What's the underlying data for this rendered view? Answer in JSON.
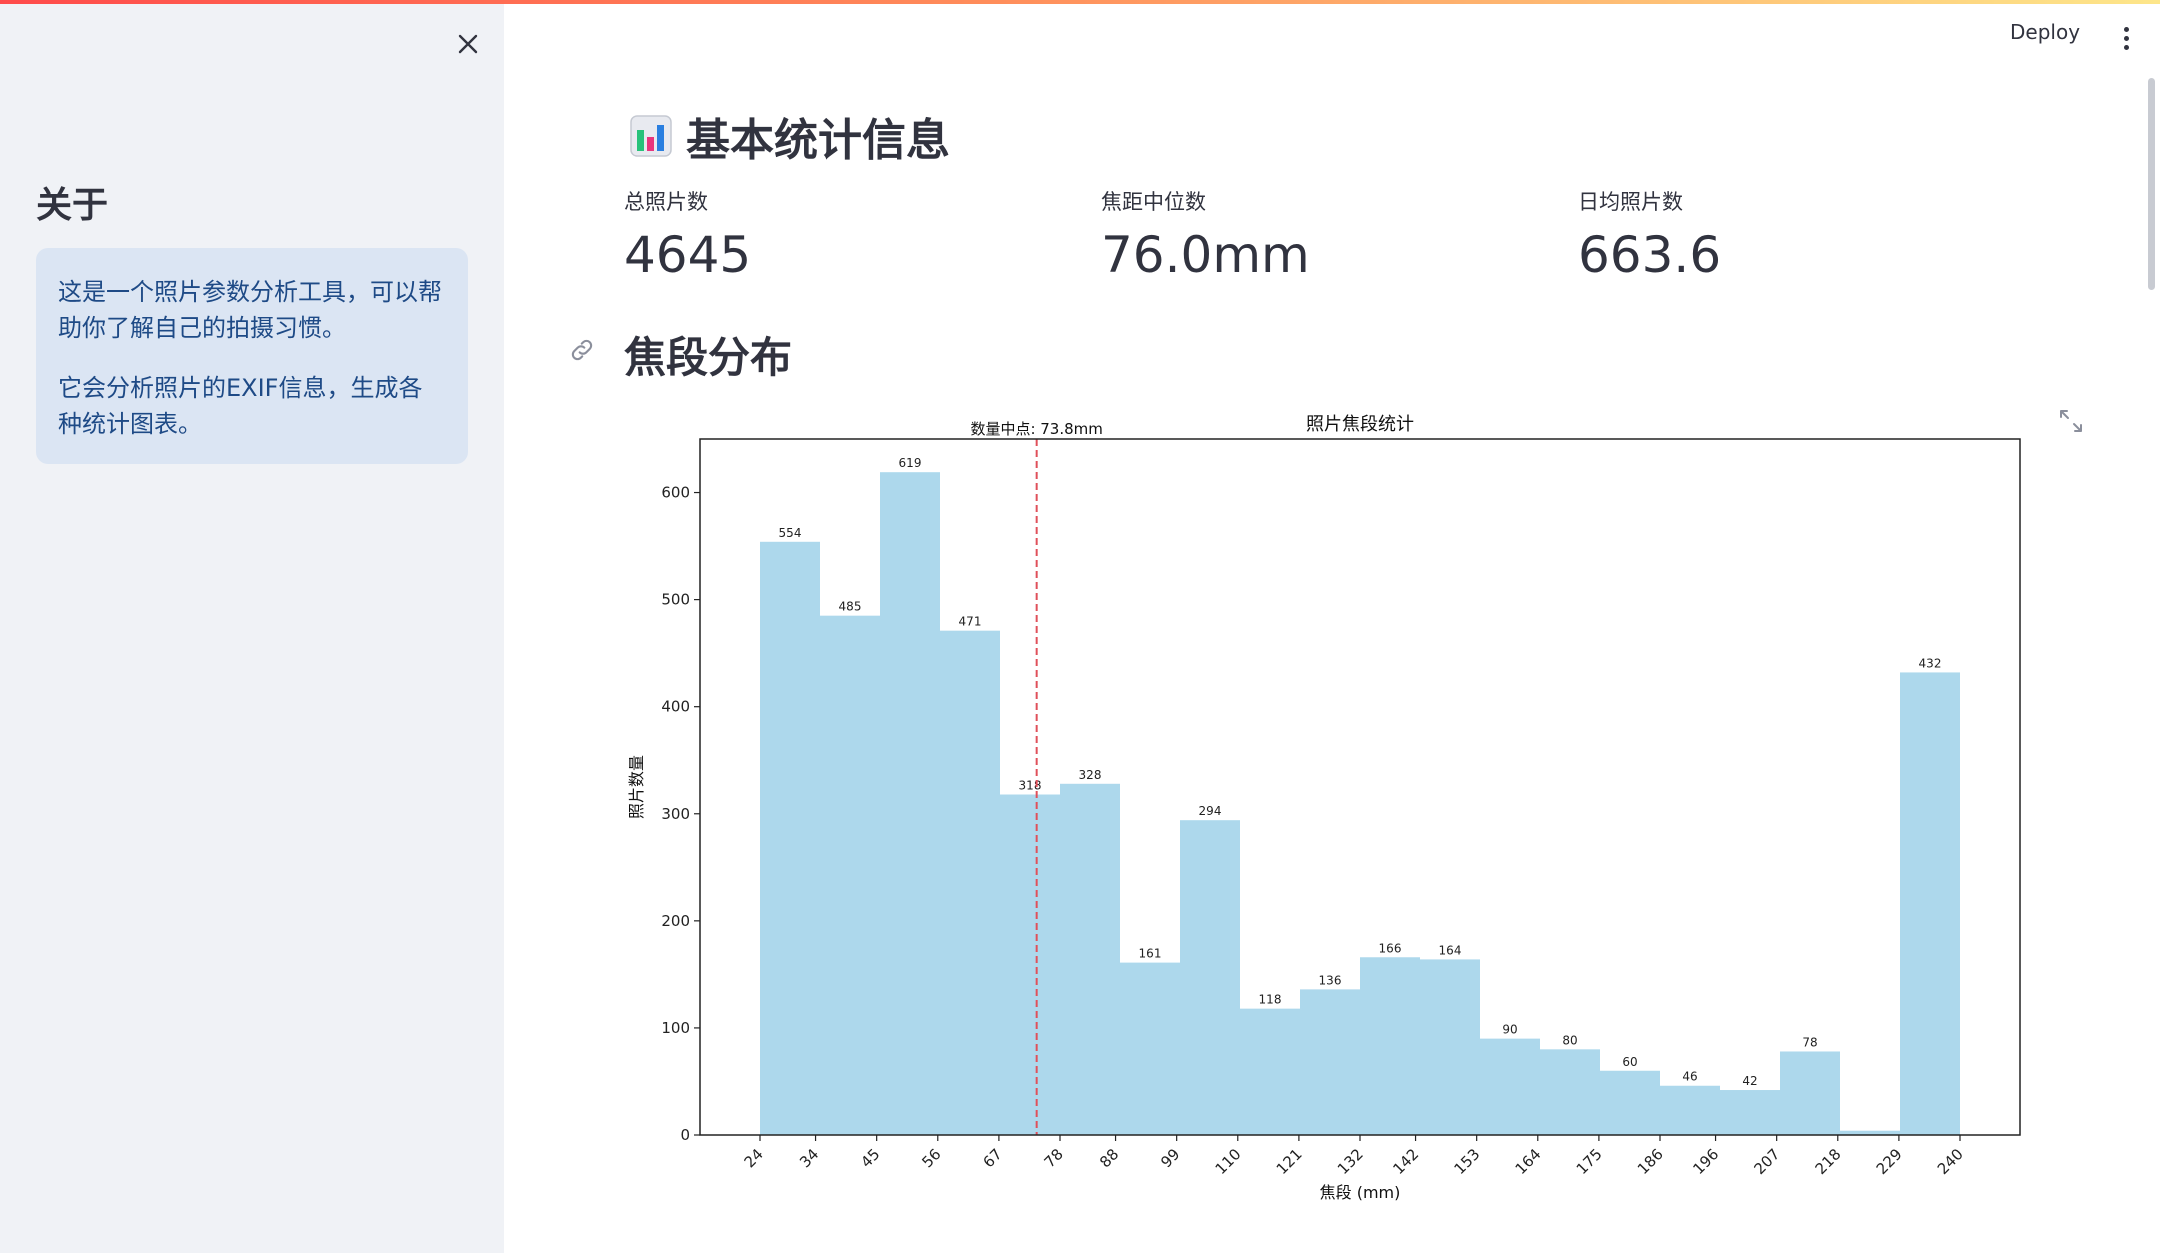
{
  "sidebar": {
    "title": "关于",
    "info_paragraphs": [
      "这是一个照片参数分析工具，可以帮助你了解自己的拍摄习惯。",
      "它会分析照片的EXIF信息，生成各种统计图表。"
    ],
    "close_icon": "close-icon"
  },
  "header": {
    "deploy_label": "Deploy",
    "menu_icon": "kebab-menu-icon"
  },
  "main": {
    "title": "基本统计信息",
    "title_icon": "bar-chart-icon",
    "metrics": [
      {
        "label": "总照片数",
        "value": "4645"
      },
      {
        "label": "焦距中位数",
        "value": "76.0mm"
      },
      {
        "label": "日均照片数",
        "value": "663.6"
      }
    ],
    "section_title": "焦段分布",
    "section_icon": "link-icon",
    "expand_icon": "fullscreen-icon"
  },
  "colors": {
    "accent": "#ff4b4b",
    "bar_fill": "#add8ec",
    "median_line": "#e0505a",
    "sidebar_bg": "#f0f2f6",
    "info_bg": "#dbe5f3",
    "info_text": "#1e4a86"
  },
  "chart_data": {
    "type": "bar",
    "title": "照片焦段统计",
    "xlabel": "焦段 (mm)",
    "ylabel": "照片数量",
    "x_ticks": [
      24,
      34,
      45,
      56,
      67,
      78,
      88,
      99,
      110,
      121,
      132,
      142,
      153,
      164,
      175,
      186,
      196,
      207,
      218,
      229,
      240
    ],
    "values": [
      554,
      485,
      619,
      471,
      318,
      328,
      161,
      294,
      118,
      136,
      166,
      164,
      90,
      80,
      60,
      46,
      42,
      78,
      4,
      432
    ],
    "value_labels": [
      "554",
      "485",
      "619",
      "471",
      "318",
      "328",
      "161",
      "294",
      "118",
      "136",
      "166",
      "164",
      "90",
      "80",
      "60",
      "46",
      "42",
      "78",
      "",
      "432"
    ],
    "y_ticks": [
      0,
      100,
      200,
      300,
      400,
      500,
      600
    ],
    "ylim": [
      0,
      650
    ],
    "median_line": {
      "x": 73.8,
      "label": "数量中点: 73.8mm"
    },
    "grid": false
  }
}
